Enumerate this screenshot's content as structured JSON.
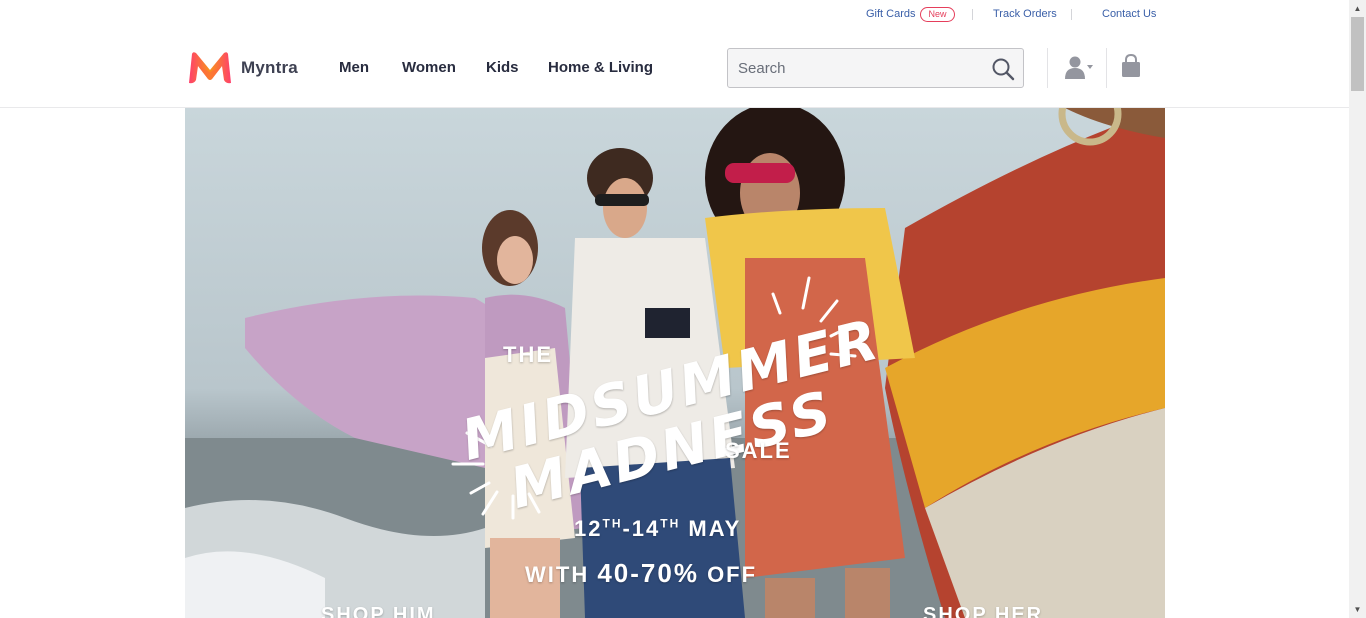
{
  "utility": {
    "gift_cards": "Gift Cards",
    "new_badge": "New",
    "track_orders": "Track Orders",
    "contact_us": "Contact Us"
  },
  "header": {
    "brand": "Myntra",
    "nav": [
      "Men",
      "Women",
      "Kids",
      "Home & Living"
    ],
    "search_placeholder": "Search",
    "icons": {
      "search": "search-icon",
      "profile": "user-icon",
      "bag": "bag-icon"
    }
  },
  "hero": {
    "line_the": "THE",
    "line_midsummer": "MIDSUMMER",
    "line_madness": "MADNESS",
    "line_sale": "SALE",
    "date_start": "12",
    "date_start_sup": "TH",
    "date_end": "-14",
    "date_end_sup": "TH",
    "date_month": " MAY",
    "offer_prefix": "WITH ",
    "offer_value": "40-70%",
    "offer_suffix": " OFF",
    "shop_him": "SHOP HIM",
    "shop_her": "SHOP HER"
  },
  "colors": {
    "brand_pink": "#ff3f6c",
    "brand_orange": "#f7931e",
    "link_blue": "#3a5fa8",
    "badge_red": "#e53e5b"
  }
}
